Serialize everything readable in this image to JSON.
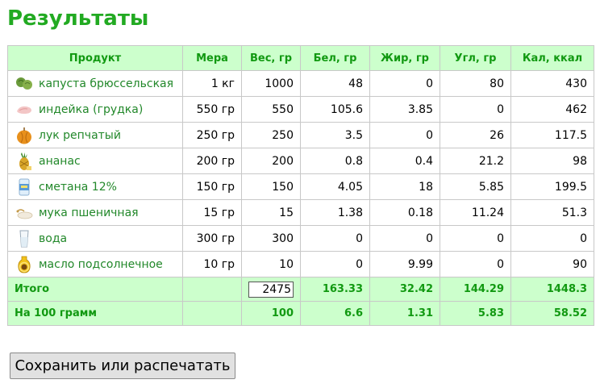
{
  "page": {
    "title": "Результаты"
  },
  "table": {
    "headers": [
      "Продукт",
      "Мера",
      "Вес, гр",
      "Бел, гр",
      "Жир, гр",
      "Угл, гр",
      "Кал, ккал"
    ],
    "rows": [
      {
        "icon": "brussels-sprouts-icon",
        "product": "капуста брюссельская",
        "measure": "1 кг",
        "weight": "1000",
        "protein": "48",
        "fat": "0",
        "carbs": "80",
        "kcal": "430"
      },
      {
        "icon": "turkey-breast-icon",
        "product": "индейка (грудка)",
        "measure": "550 гр",
        "weight": "550",
        "protein": "105.6",
        "fat": "3.85",
        "carbs": "0",
        "kcal": "462"
      },
      {
        "icon": "onion-icon",
        "product": "лук репчатый",
        "measure": "250 гр",
        "weight": "250",
        "protein": "3.5",
        "fat": "0",
        "carbs": "26",
        "kcal": "117.5"
      },
      {
        "icon": "pineapple-icon",
        "product": "ананас",
        "measure": "200 гр",
        "weight": "200",
        "protein": "0.8",
        "fat": "0.4",
        "carbs": "21.2",
        "kcal": "98"
      },
      {
        "icon": "sour-cream-icon",
        "product": "сметана 12%",
        "measure": "150 гр",
        "weight": "150",
        "protein": "4.05",
        "fat": "18",
        "carbs": "5.85",
        "kcal": "199.5"
      },
      {
        "icon": "wheat-flour-icon",
        "product": "мука пшеничная",
        "measure": "15 гр",
        "weight": "15",
        "protein": "1.38",
        "fat": "0.18",
        "carbs": "11.24",
        "kcal": "51.3"
      },
      {
        "icon": "water-glass-icon",
        "product": "вода",
        "measure": "300 гр",
        "weight": "300",
        "protein": "0",
        "fat": "0",
        "carbs": "0",
        "kcal": "0"
      },
      {
        "icon": "sunflower-oil-icon",
        "product": "масло подсолнечное",
        "measure": "10 гр",
        "weight": "10",
        "protein": "0",
        "fat": "9.99",
        "carbs": "0",
        "kcal": "90"
      }
    ],
    "total": {
      "label": "Итого",
      "measure": "",
      "weight": "2475",
      "protein": "163.33",
      "fat": "32.42",
      "carbs": "144.29",
      "kcal": "1448.3"
    },
    "per100": {
      "label": "На 100 грамм",
      "measure": "",
      "weight": "100",
      "protein": "6.6",
      "fat": "1.31",
      "carbs": "5.83",
      "kcal": "58.52"
    }
  },
  "actions": {
    "save_label": "Сохранить или распечатать"
  },
  "colors": {
    "accent": "#22aa22",
    "header_bg": "#ccffcc",
    "header_text": "#119911",
    "link": "#22882a",
    "border": "#c8c8c8"
  }
}
